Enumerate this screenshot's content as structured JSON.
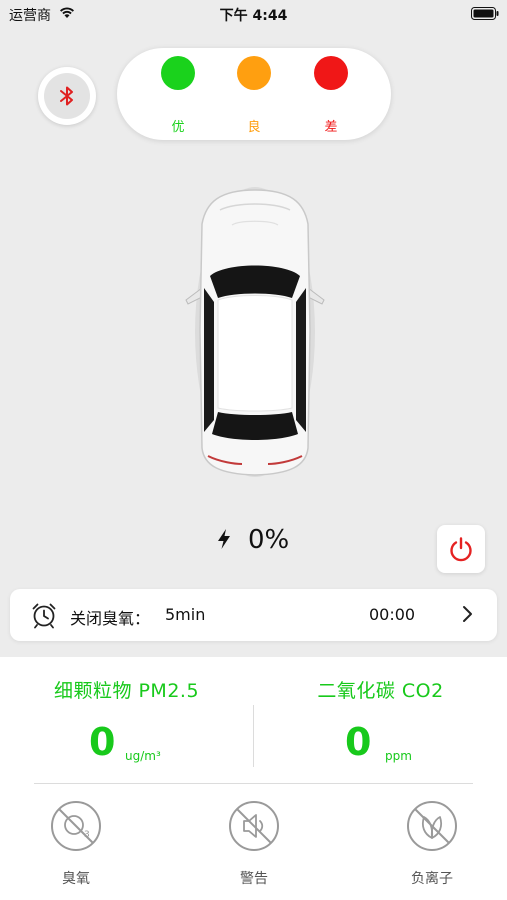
{
  "status_bar": {
    "carrier": "运营商",
    "time": "下午 4:44"
  },
  "bluetooth": {
    "icon": "bluetooth-icon",
    "color": "#e02020"
  },
  "air_quality_legend": [
    {
      "label": "优",
      "color": "#1ad21c"
    },
    {
      "label": "良",
      "color": "#ff9f10"
    },
    {
      "label": "差",
      "color": "#f01717"
    }
  ],
  "battery": {
    "value": "0%",
    "icon": "lightning-icon"
  },
  "power": {
    "icon": "power-icon",
    "color": "#e52222"
  },
  "timer": {
    "label": "关闭臭氧：",
    "value": "5min",
    "countdown": "00:00"
  },
  "sensors": {
    "pm25": {
      "title": "细颗粒物 PM2.5",
      "value": "0",
      "unit": "ug/m³"
    },
    "co2": {
      "title": "二氧化碳 CO2",
      "value": "0",
      "unit": "ppm"
    }
  },
  "toggles": [
    {
      "label": "臭氧",
      "icon": "ozone-off-icon"
    },
    {
      "label": "警告",
      "icon": "speaker-off-icon"
    },
    {
      "label": "负离子",
      "icon": "leaf-off-icon"
    }
  ],
  "accent_green": "#18c91b"
}
